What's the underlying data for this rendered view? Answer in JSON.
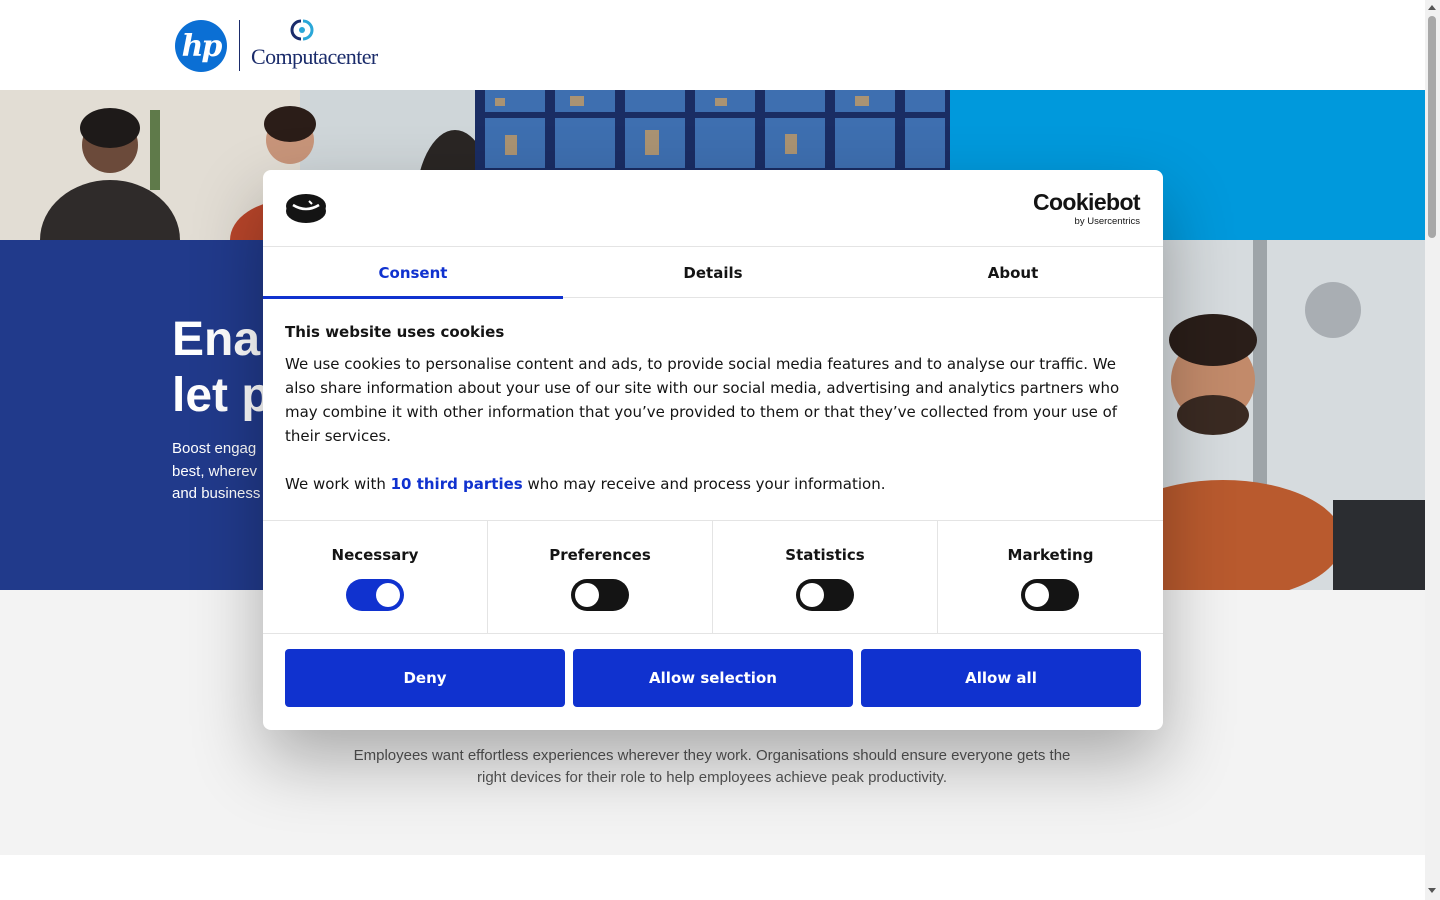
{
  "header": {
    "hp_logo_text": "hp",
    "partner_logo_text": "Computacenter"
  },
  "hero": {
    "title_line1": "Ena",
    "title_line2": "let p",
    "subtitle_line1": "Boost engag",
    "subtitle_line2": "best, wherev",
    "subtitle_line3": "and business"
  },
  "section": {
    "text_line1": "Employees want effortless experiences wherever they work. Organisations should ensure everyone gets the",
    "text_line2": "right devices for their role to help employees achieve peak productivity."
  },
  "cookie_dialog": {
    "brand": "Cookiebot",
    "brand_by": "by Usercentrics",
    "tabs": [
      {
        "label": "Consent",
        "active": true
      },
      {
        "label": "Details",
        "active": false
      },
      {
        "label": "About",
        "active": false
      }
    ],
    "heading": "This website uses cookies",
    "body": "We use cookies to personalise content and ads, to provide social media features and to analyse our traffic. We also share information about your use of our site with our social media, advertising and analytics partners who may combine it with other information that you’ve provided to them or that they’ve collected from your use of their services.",
    "third_parties_prefix": "We work with ",
    "third_parties_link": "10 third parties",
    "third_parties_suffix": " who may receive and process your information.",
    "toggles": [
      {
        "label": "Necessary",
        "on": true
      },
      {
        "label": "Preferences",
        "on": false
      },
      {
        "label": "Statistics",
        "on": false
      },
      {
        "label": "Marketing",
        "on": false
      }
    ],
    "buttons": {
      "deny": "Deny",
      "allow_selection": "Allow selection",
      "allow_all": "Allow all"
    }
  },
  "colors": {
    "accent": "#1032cf",
    "hero_blue": "#213a8b",
    "sky_blue": "#0099dc"
  }
}
